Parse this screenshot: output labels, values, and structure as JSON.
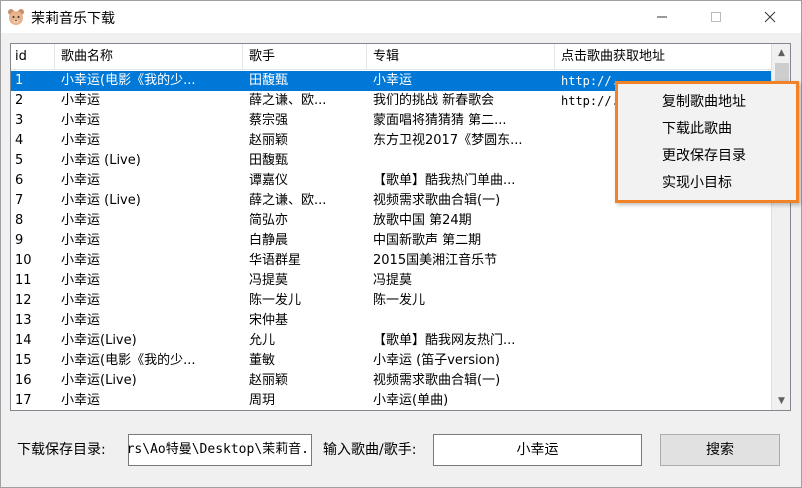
{
  "window": {
    "title": "茉莉音乐下载"
  },
  "table": {
    "columns": [
      "id",
      "歌曲名称",
      "歌手",
      "专辑",
      "点击歌曲获取地址"
    ],
    "rows": [
      {
        "id": "1",
        "name": "小幸运(电影《我的少...",
        "singer": "田馥甄",
        "album": "小幸运",
        "url": "http://...",
        "selected": true
      },
      {
        "id": "2",
        "name": "小幸运",
        "singer": "薛之谦、欧...",
        "album": "我们的挑战 新春歌会",
        "url": "http://..."
      },
      {
        "id": "3",
        "name": "小幸运",
        "singer": "蔡宗强",
        "album": "蒙面唱将猜猜猜 第二...",
        "url": ""
      },
      {
        "id": "4",
        "name": "小幸运",
        "singer": "赵丽颖",
        "album": "东方卫视2017《梦圆东...",
        "url": ""
      },
      {
        "id": "5",
        "name": "小幸运 (Live)",
        "singer": "田馥甄",
        "album": "",
        "url": ""
      },
      {
        "id": "6",
        "name": "小幸运",
        "singer": "谭嘉仪",
        "album": "【歌单】酷我热门单曲...",
        "url": ""
      },
      {
        "id": "7",
        "name": "小幸运 (Live)",
        "singer": "薛之谦、欧...",
        "album": "视频需求歌曲合辑(一)",
        "url": ""
      },
      {
        "id": "8",
        "name": "小幸运",
        "singer": "简弘亦",
        "album": "放歌中国 第24期",
        "url": ""
      },
      {
        "id": "9",
        "name": "小幸运",
        "singer": "白静晨",
        "album": "中国新歌声 第二期",
        "url": ""
      },
      {
        "id": "10",
        "name": "小幸运",
        "singer": "华语群星",
        "album": "2015国美湘江音乐节",
        "url": ""
      },
      {
        "id": "11",
        "name": "小幸运",
        "singer": "冯提莫",
        "album": "冯提莫",
        "url": ""
      },
      {
        "id": "12",
        "name": "小幸运",
        "singer": "陈一发儿",
        "album": "陈一发儿",
        "url": ""
      },
      {
        "id": "13",
        "name": "小幸运",
        "singer": "宋仲基",
        "album": "",
        "url": ""
      },
      {
        "id": "14",
        "name": "小幸运(Live)",
        "singer": "允儿",
        "album": "【歌单】酷我网友热门...",
        "url": ""
      },
      {
        "id": "15",
        "name": "小幸运(电影《我的少...",
        "singer": "董敏",
        "album": "小幸运 (笛子version)",
        "url": ""
      },
      {
        "id": "16",
        "name": "小幸运(Live)",
        "singer": "赵丽颖",
        "album": "视频需求歌曲合辑(一)",
        "url": ""
      },
      {
        "id": "17",
        "name": "小幸运",
        "singer": "周玥",
        "album": "小幸运(单曲)",
        "url": ""
      }
    ]
  },
  "context_menu": {
    "items": [
      "复制歌曲地址",
      "下载此歌曲",
      "更改保存目录",
      "实现小目标"
    ]
  },
  "bottom": {
    "save_dir_label": "下载保存目录:",
    "save_dir_value": "C:\\Users\\Ao特曼\\Desktop\\茉莉音.",
    "search_label": "输入歌曲/歌手:",
    "search_value": "小幸运",
    "search_button": "搜索"
  },
  "colors": {
    "selection": "#0078d7",
    "menu_highlight_border": "#f08227"
  }
}
